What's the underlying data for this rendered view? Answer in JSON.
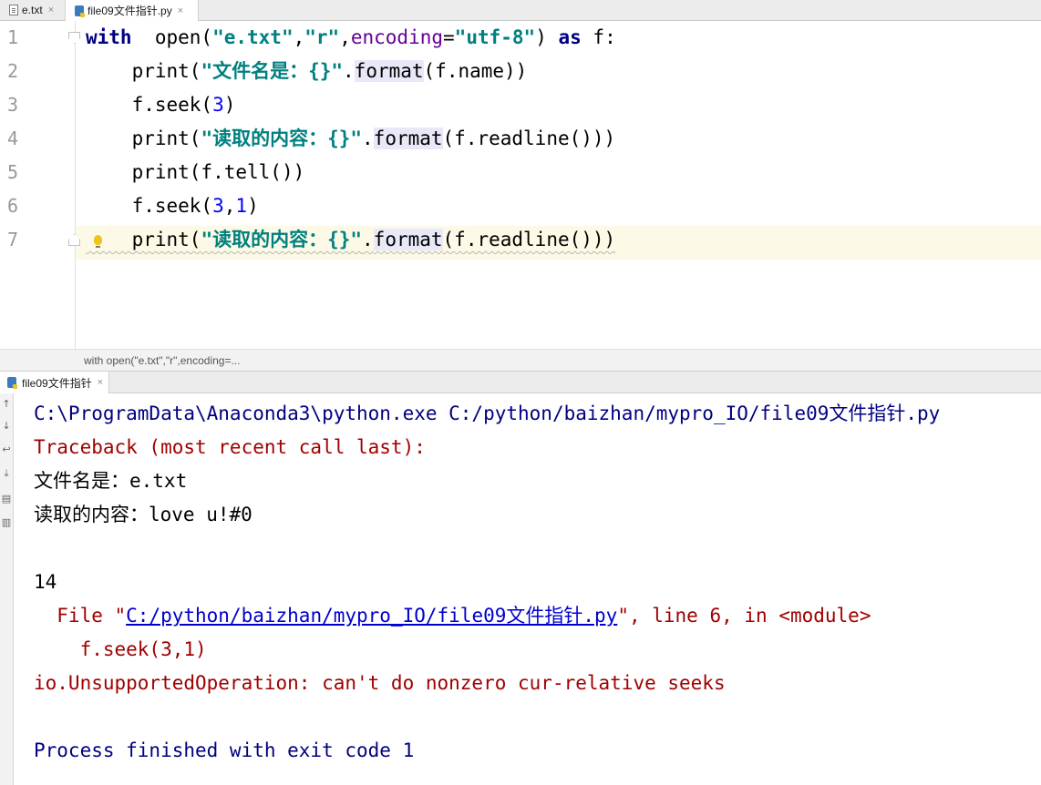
{
  "tabs": [
    {
      "label": "e.txt",
      "close": "×"
    },
    {
      "label": "file09文件指针.py",
      "close": "×"
    }
  ],
  "editor": {
    "line_numbers": [
      "1",
      "2",
      "3",
      "4",
      "5",
      "6",
      "7"
    ],
    "lines": [
      {
        "indent": "",
        "segments": [
          [
            "kw",
            "with"
          ],
          [
            "",
            "  open("
          ],
          [
            "str",
            "\"e.txt\""
          ],
          [
            "",
            ","
          ],
          [
            "str",
            "\"r\""
          ],
          [
            "",
            ","
          ],
          [
            "param",
            "encoding"
          ],
          [
            "",
            "="
          ],
          [
            "str",
            "\"utf-8\""
          ],
          [
            "",
            ") "
          ],
          [
            "kw",
            "as"
          ],
          [
            "",
            " f:"
          ]
        ]
      },
      {
        "indent": "    ",
        "segments": [
          [
            "",
            "print("
          ],
          [
            "str",
            "\"文件名是：{}\""
          ],
          [
            "",
            "."
          ],
          [
            "hl",
            "format"
          ],
          [
            "",
            "(f.name))"
          ]
        ]
      },
      {
        "indent": "    ",
        "segments": [
          [
            "",
            "f.seek("
          ],
          [
            "num",
            "3"
          ],
          [
            "",
            ")"
          ]
        ]
      },
      {
        "indent": "    ",
        "segments": [
          [
            "",
            "print("
          ],
          [
            "str",
            "\"读取的内容：{}\""
          ],
          [
            "",
            "."
          ],
          [
            "hl",
            "format"
          ],
          [
            "",
            "(f.readline()))"
          ]
        ]
      },
      {
        "indent": "    ",
        "segments": [
          [
            "",
            "print(f.tell())"
          ]
        ]
      },
      {
        "indent": "    ",
        "segments": [
          [
            "",
            "f.seek("
          ],
          [
            "num",
            "3"
          ],
          [
            "",
            ","
          ],
          [
            "num",
            "1"
          ],
          [
            "",
            ")"
          ]
        ]
      },
      {
        "indent": "    ",
        "segments": [
          [
            "",
            "print("
          ],
          [
            "str",
            "\"读取的内容：{}\""
          ],
          [
            "",
            "."
          ],
          [
            "hl",
            "format"
          ],
          [
            "",
            "(f.readline()))"
          ]
        ]
      }
    ],
    "breadcrumb": "with open(\"e.txt\",\"r\",encoding=..."
  },
  "run": {
    "tab_label": "file09文件指针",
    "tab_close": "×",
    "output": [
      {
        "type": "sys",
        "text": "C:\\ProgramData\\Anaconda3\\python.exe C:/python/baizhan/mypro_IO/file09文件指针.py"
      },
      {
        "type": "err",
        "text": "Traceback (most recent call last):"
      },
      {
        "type": "std",
        "text": "文件名是：e.txt"
      },
      {
        "type": "std",
        "text": "读取的内容：love u!#0"
      },
      {
        "type": "std",
        "text": ""
      },
      {
        "type": "std",
        "text": "14"
      },
      {
        "type": "err_link",
        "prefix": "  File \"",
        "link": "C:/python/baizhan/mypro_IO/file09文件指针.py",
        "suffix": "\", line 6, in <module>"
      },
      {
        "type": "err",
        "text": "    f.seek(3,1)"
      },
      {
        "type": "err",
        "text": "io.UnsupportedOperation: can't do nonzero cur-relative seeks"
      },
      {
        "type": "std",
        "text": ""
      },
      {
        "type": "sys",
        "text": "Process finished with exit code 1"
      }
    ]
  },
  "toolstrip_icons": [
    "arrow-up-icon",
    "arrow-down-icon",
    "soft-wrap-icon",
    "scroll-to-end-icon",
    "print-icon",
    "trash-icon"
  ],
  "colors": {
    "keyword": "#000080",
    "string": "#008080",
    "number": "#0000ff",
    "param": "#660099",
    "error": "#a00000",
    "current_line": "#fcfae6"
  }
}
